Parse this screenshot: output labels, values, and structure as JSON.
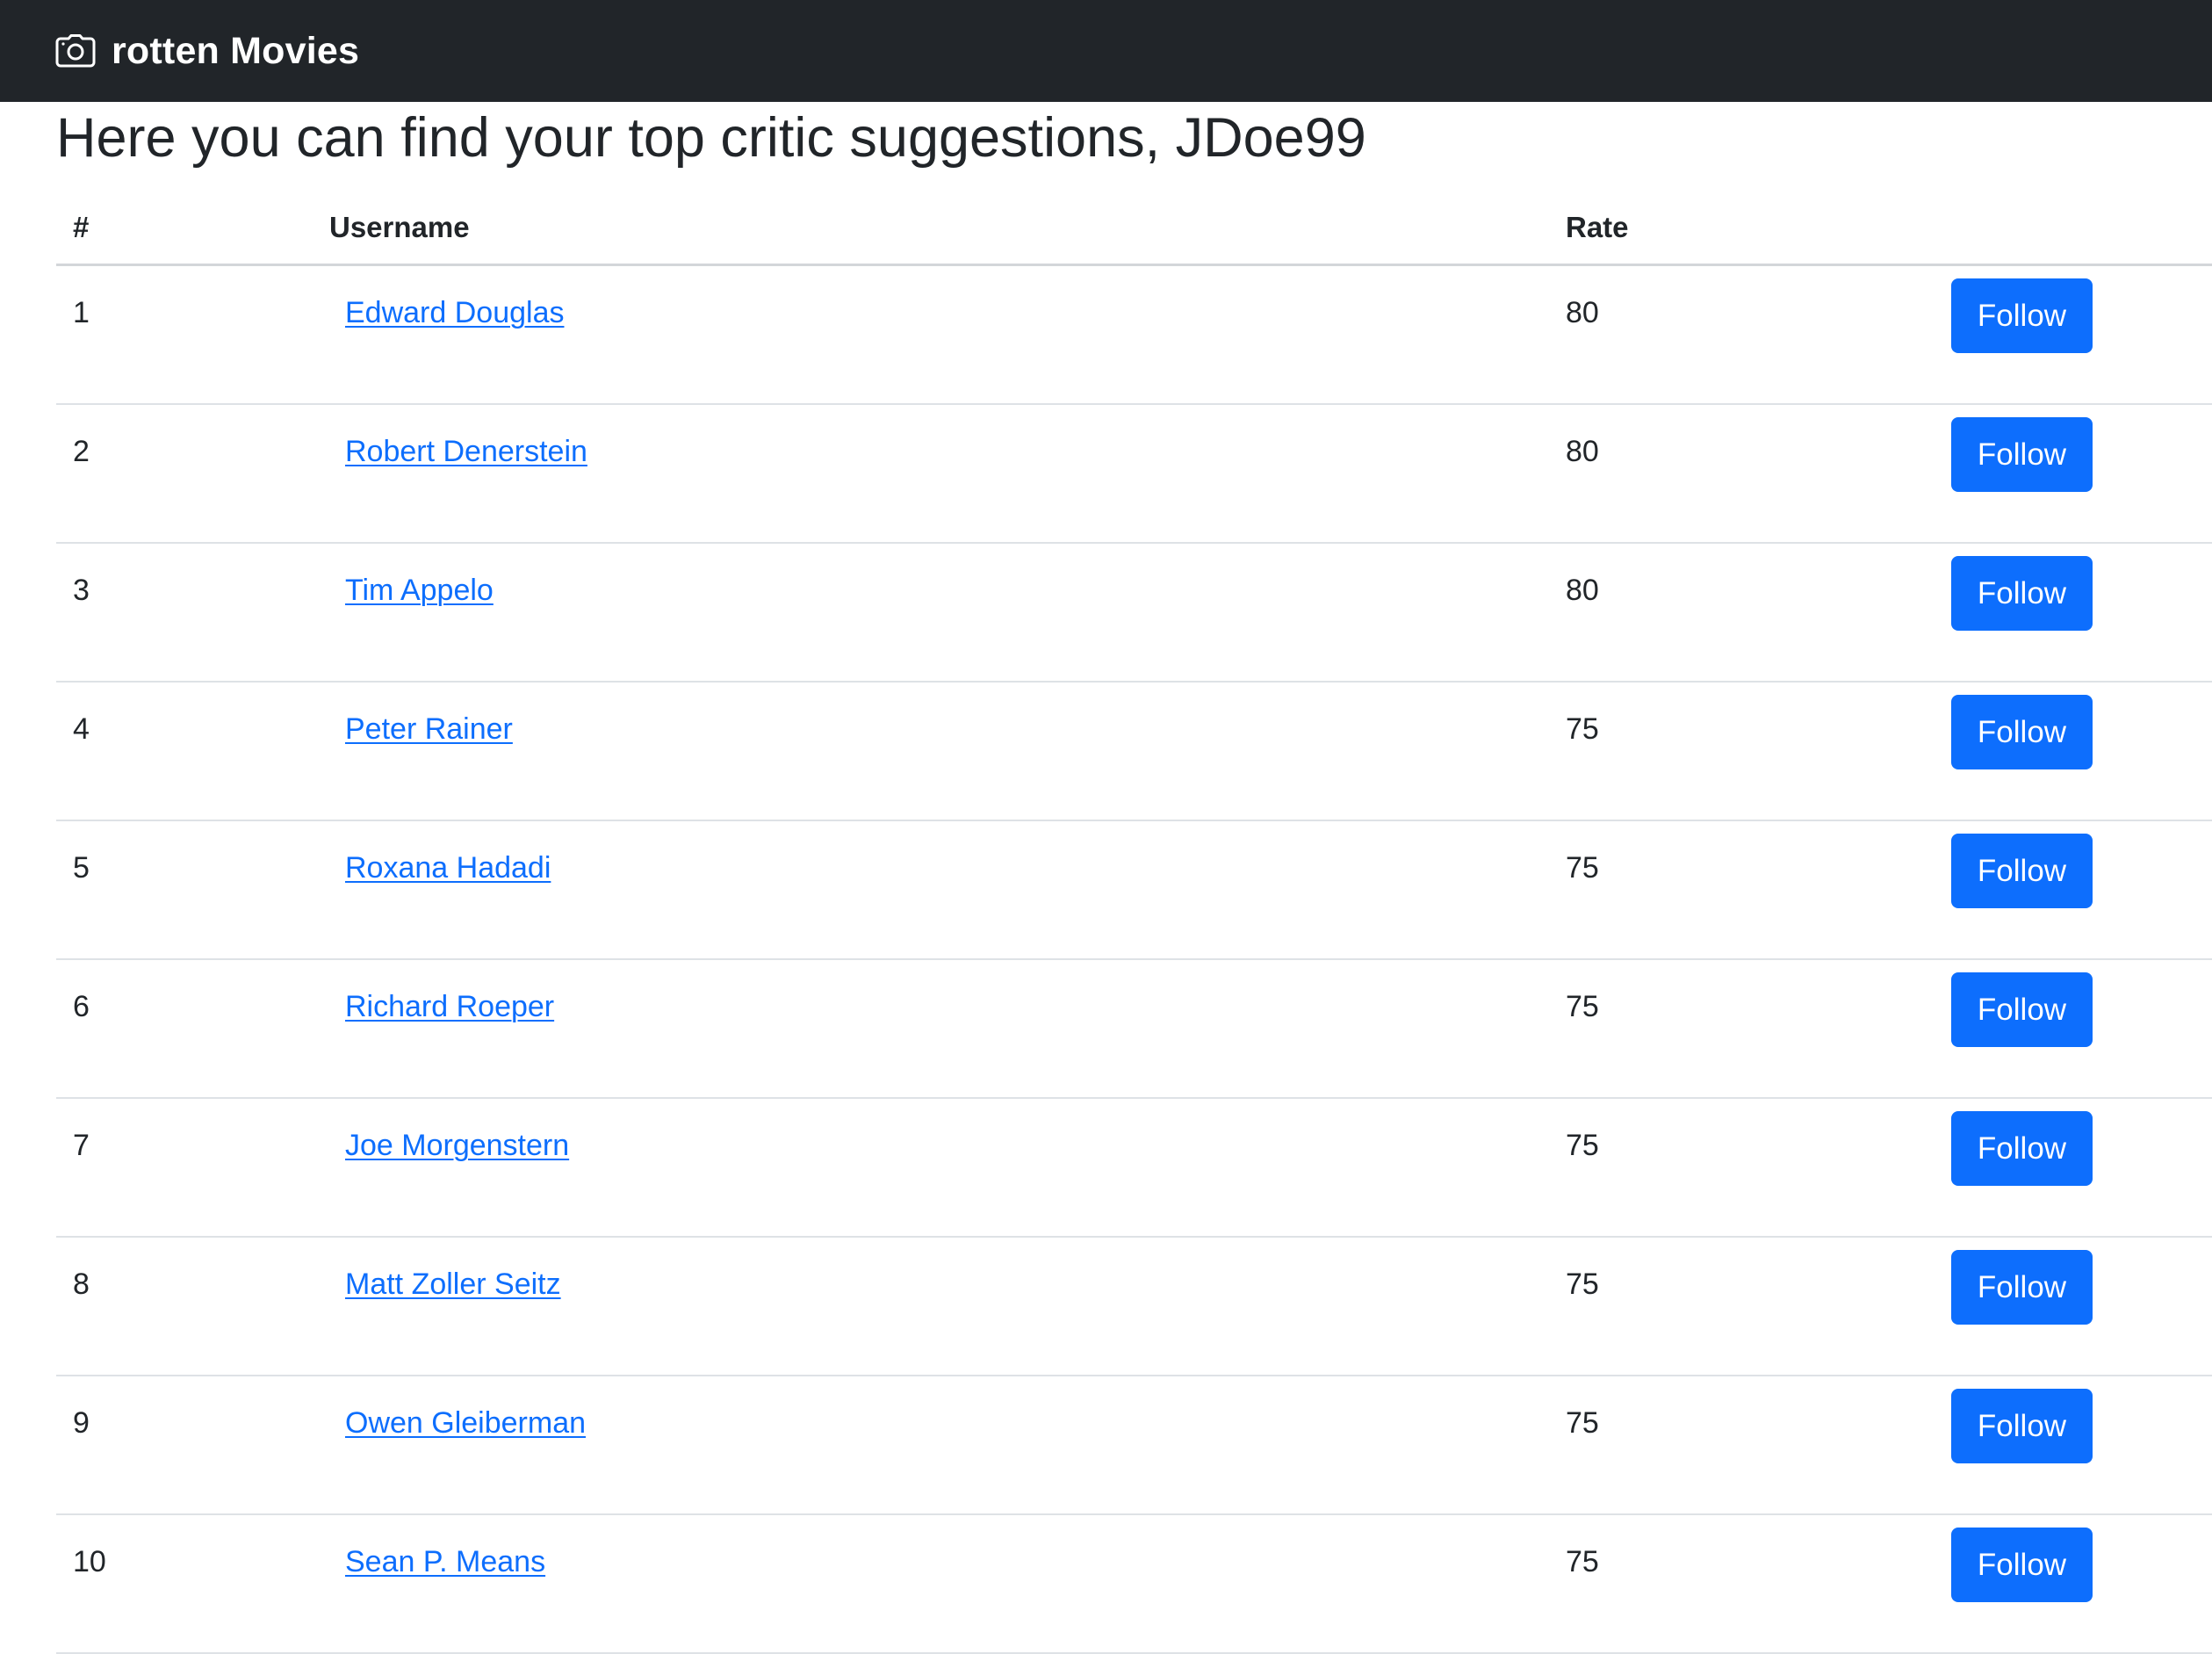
{
  "navbar": {
    "brand_icon": "camera-icon",
    "brand_text": "rotten Movies",
    "background": "#212529"
  },
  "page": {
    "title": "Here you can find your top critic suggestions, JDoe99"
  },
  "table": {
    "headers": {
      "num": "#",
      "username": "Username",
      "rate": "Rate",
      "action": ""
    },
    "rows": [
      {
        "num": "1",
        "username": "Edward Douglas",
        "rate": "80",
        "action": "Follow"
      },
      {
        "num": "2",
        "username": "Robert Denerstein",
        "rate": "80",
        "action": "Follow"
      },
      {
        "num": "3",
        "username": "Tim Appelo",
        "rate": "80",
        "action": "Follow"
      },
      {
        "num": "4",
        "username": "Peter Rainer",
        "rate": "75",
        "action": "Follow"
      },
      {
        "num": "5",
        "username": "Roxana Hadadi",
        "rate": "75",
        "action": "Follow"
      },
      {
        "num": "6",
        "username": "Richard Roeper",
        "rate": "75",
        "action": "Follow"
      },
      {
        "num": "7",
        "username": "Joe Morgenstern",
        "rate": "75",
        "action": "Follow"
      },
      {
        "num": "8",
        "username": "Matt Zoller Seitz",
        "rate": "75",
        "action": "Follow"
      },
      {
        "num": "9",
        "username": "Owen Gleiberman",
        "rate": "75",
        "action": "Follow"
      },
      {
        "num": "10",
        "username": "Sean P. Means",
        "rate": "75",
        "action": "Follow"
      }
    ]
  },
  "colors": {
    "link": "#0d6efd",
    "button": "#0d6efd",
    "button_text": "#ffffff"
  }
}
